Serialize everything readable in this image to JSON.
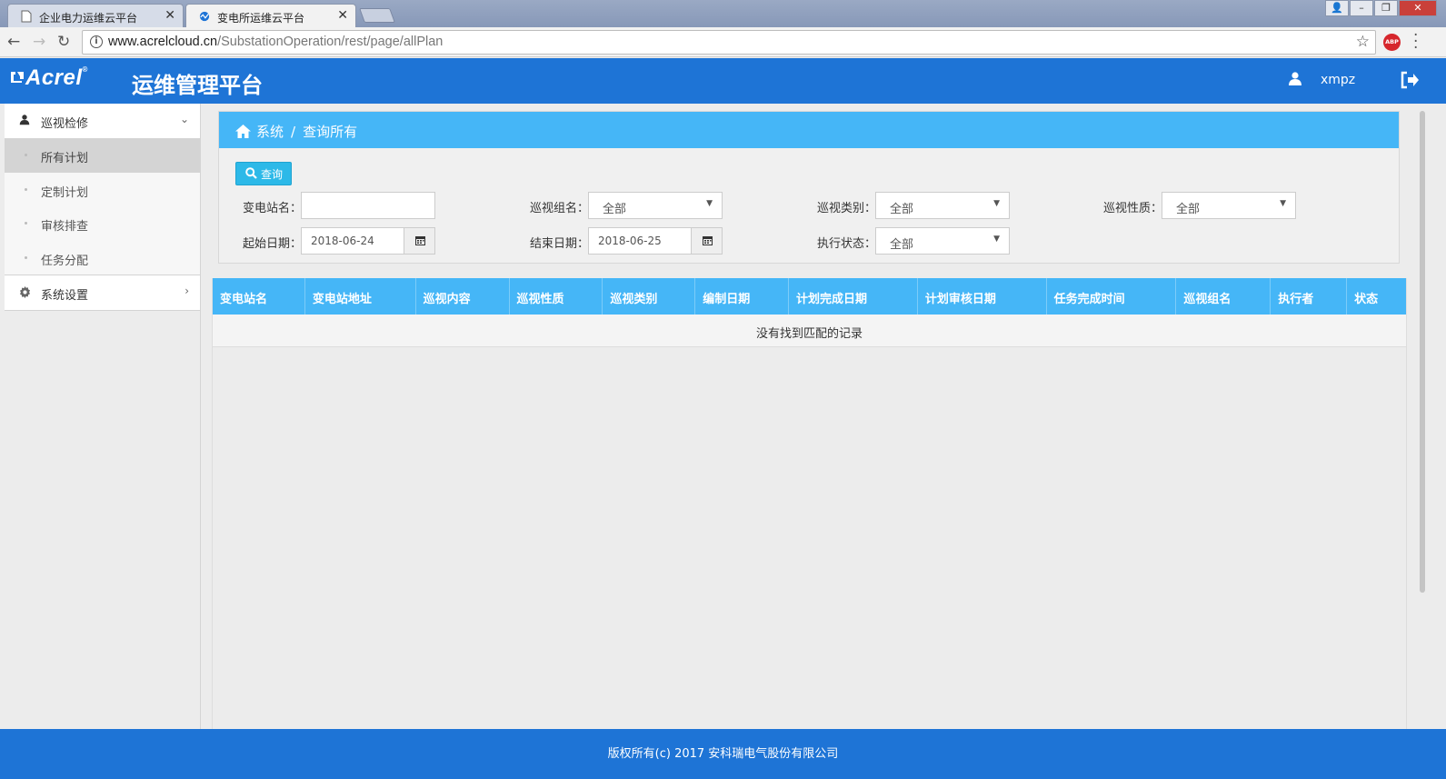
{
  "browser": {
    "tabs": [
      {
        "title": "企业电力运维云平台",
        "active": false
      },
      {
        "title": "变电所运维云平台",
        "active": true
      }
    ],
    "close_glyph": "✕",
    "url_host": "www.acrelcloud.cn",
    "url_path": "/SubstationOperation/rest/page/allPlan",
    "extension_badge": "ABP"
  },
  "header": {
    "logo": "Acrel",
    "logo_mark": "®",
    "title": "运维管理平台",
    "username": "xmpz",
    "brand_color": "#1e74d6"
  },
  "sidebar": {
    "groups": [
      {
        "label": "巡视检修",
        "icon": "user-icon",
        "expanded": true,
        "items": [
          {
            "label": "所有计划",
            "active": true
          },
          {
            "label": "定制计划",
            "active": false
          },
          {
            "label": "审核排查",
            "active": false
          },
          {
            "label": "任务分配",
            "active": false
          }
        ]
      },
      {
        "label": "系统设置",
        "icon": "gear-icon",
        "expanded": false
      }
    ]
  },
  "breadcrumb": {
    "home": "系统",
    "separator": "/",
    "current": "查询所有"
  },
  "toolbar": {
    "query_label": "查询"
  },
  "filters": {
    "station_name": {
      "label": "变电站名：",
      "value": ""
    },
    "patrol_group": {
      "label": "巡视组名：",
      "value": "全部"
    },
    "patrol_type": {
      "label": "巡视类别：",
      "value": "全部"
    },
    "patrol_nature": {
      "label": "巡视性质：",
      "value": "全部"
    },
    "start_date": {
      "label": "起始日期：",
      "value": "2018-06-24"
    },
    "end_date": {
      "label": "结束日期：",
      "value": "2018-06-25"
    },
    "exec_status": {
      "label": "执行状态：",
      "value": "全部"
    }
  },
  "table": {
    "columns": [
      "变电站名",
      "变电站地址",
      "巡视内容",
      "巡视性质",
      "巡视类别",
      "编制日期",
      "计划完成日期",
      "计划审核日期",
      "任务完成时间",
      "巡视组名",
      "执行者",
      "状态"
    ],
    "empty_text": "没有找到匹配的记录",
    "header_color": "#45b6f7"
  },
  "footer": {
    "copyright": "版权所有(c) 2017 安科瑞电气股份有限公司"
  }
}
